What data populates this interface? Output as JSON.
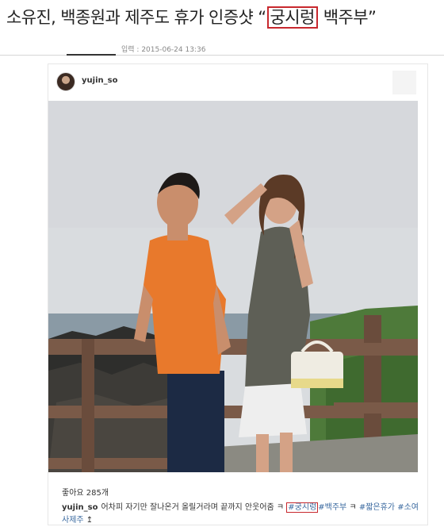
{
  "article": {
    "headline_before": "소유진, 백종원과 제주도 휴가 인증샷 “",
    "headline_highlight": "궁시렁",
    "headline_after": " 백주부”",
    "date_label": "입력 : 2015-06-24 13:36"
  },
  "post": {
    "username": "yujin_so",
    "likes": "좋아요 285개",
    "caption_user": "yujin_so",
    "caption_text": "어차피 자기만 잘나온거 올릴거라며 끝까지 안웃어줌 ㅋ ",
    "tag_highlight": "#궁시렁",
    "tag_1": "#백주부",
    "caption_mid": " ㅋ ",
    "tag_2": "#짧은휴가",
    "tag_3": "#소여사제주",
    "caption_end": " ↥"
  },
  "colors": {
    "highlight_border": "#c8282e",
    "hashtag": "#3b6aa0"
  }
}
